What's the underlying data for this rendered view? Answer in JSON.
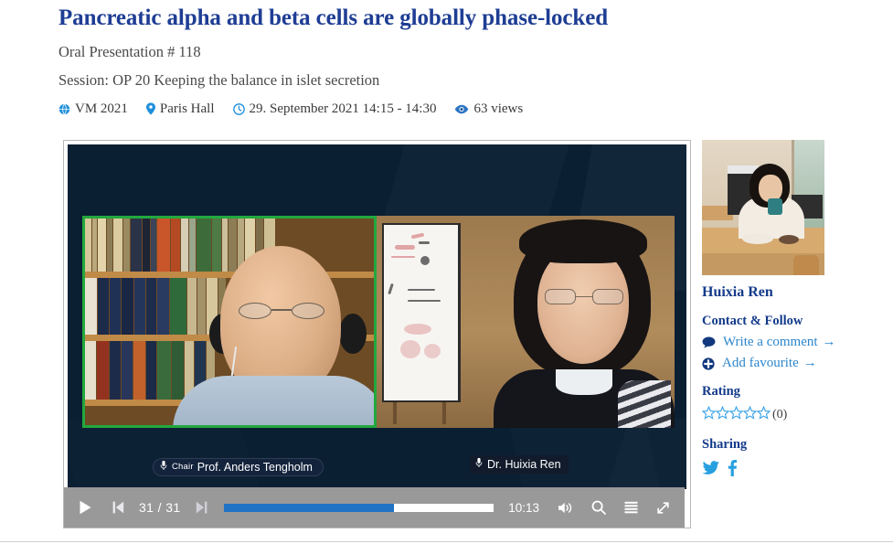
{
  "header": {
    "title": "Pancreatic alpha and beta cells are globally phase-locked",
    "presentation": "Oral Presentation # 118",
    "session": "Session: OP 20 Keeping the balance in islet secretion",
    "meta": [
      {
        "icon": "globe-icon",
        "label": "VM 2021"
      },
      {
        "icon": "location-pin-icon",
        "label": "Paris Hall"
      },
      {
        "icon": "clock-icon",
        "label": "29. September 2021 14:15 - 14:30"
      },
      {
        "icon": "eye-icon",
        "label": "63 views"
      }
    ]
  },
  "player": {
    "speakers": [
      {
        "role": "Chair",
        "name": "Prof. Anders Tengholm"
      },
      {
        "role": "",
        "name": "Dr. Huixia Ren"
      }
    ],
    "controls": {
      "play_label": "play",
      "prev_label": "previous-slide",
      "next_label": "next-slide",
      "slide_counter": "31 / 31",
      "time_remaining": "10:13",
      "progress_percent": 63,
      "volume_label": "volume",
      "search_label": "search",
      "list_label": "slide-list",
      "fullscreen_label": "fullscreen"
    }
  },
  "sidebar": {
    "speaker_name": "Huixia Ren",
    "contact_heading": "Contact & Follow",
    "links": [
      {
        "icon": "comment-icon",
        "label": "Write a comment",
        "arrow": "→"
      },
      {
        "icon": "plus-circle-icon",
        "label": "Add favourite",
        "arrow": "→"
      }
    ],
    "rating_heading": "Rating",
    "rating_stars": 5,
    "rating_count": "(0)",
    "sharing_heading": "Sharing",
    "share": [
      {
        "icon": "twitter-icon",
        "label": "Twitter"
      },
      {
        "icon": "facebook-icon",
        "label": "Facebook"
      }
    ]
  },
  "colors": {
    "title_blue": "#1e3d94",
    "link_blue": "#2a86cd",
    "icon_blue": "#1f8fdc",
    "progress_blue": "#2072c4",
    "active_speaker_green": "#22a83e",
    "control_bar_gray": "#999999"
  }
}
